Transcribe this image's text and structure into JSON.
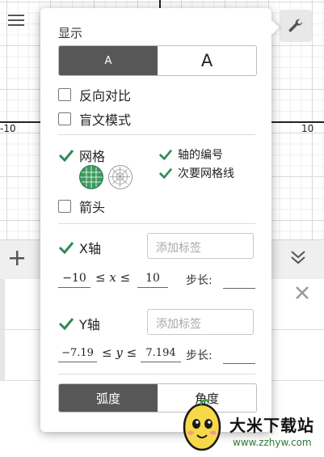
{
  "graph": {
    "tick_left": "-10",
    "tick_right": "10"
  },
  "toolbar": {
    "menu_icon": "hamburger-icon",
    "wrench_icon": "wrench-icon",
    "add_icon": "plus-icon",
    "collapse_icon": "double-chevron-down-icon",
    "close_icon": "close-icon"
  },
  "settings": {
    "display_title": "显示",
    "font_size_options": [
      "A",
      "A"
    ],
    "font_size_selected": 0,
    "reverse_contrast_label": "反向对比",
    "reverse_contrast_checked": false,
    "braille_label": "盲文模式",
    "braille_checked": false,
    "grid_label": "网格",
    "grid_checked": true,
    "axis_numbers_label": "轴的编号",
    "axis_numbers_checked": true,
    "minor_gridlines_label": "次要网格线",
    "minor_gridlines_checked": true,
    "arrows_label": "箭头",
    "arrows_checked": false,
    "x_axis": {
      "label": "X轴",
      "checked": true,
      "placeholder": "添加标签",
      "min": "−10",
      "relation": "≤ x ≤",
      "max": "10",
      "step_label": "步长:",
      "step_value": ""
    },
    "y_axis": {
      "label": "Y轴",
      "checked": true,
      "placeholder": "添加标签",
      "min": "−7.19",
      "relation": "≤ y ≤",
      "max": "7.194",
      "step_label": "步长:",
      "step_value": ""
    },
    "angle_options": [
      "弧度",
      "角度"
    ],
    "angle_selected": 0
  },
  "watermark": {
    "title": "大米下载站",
    "url": "www.zzhyw.com"
  },
  "colors": {
    "check": "#2e8b57",
    "segment_active": "#575757",
    "grid_icon": "#2e8b57"
  }
}
